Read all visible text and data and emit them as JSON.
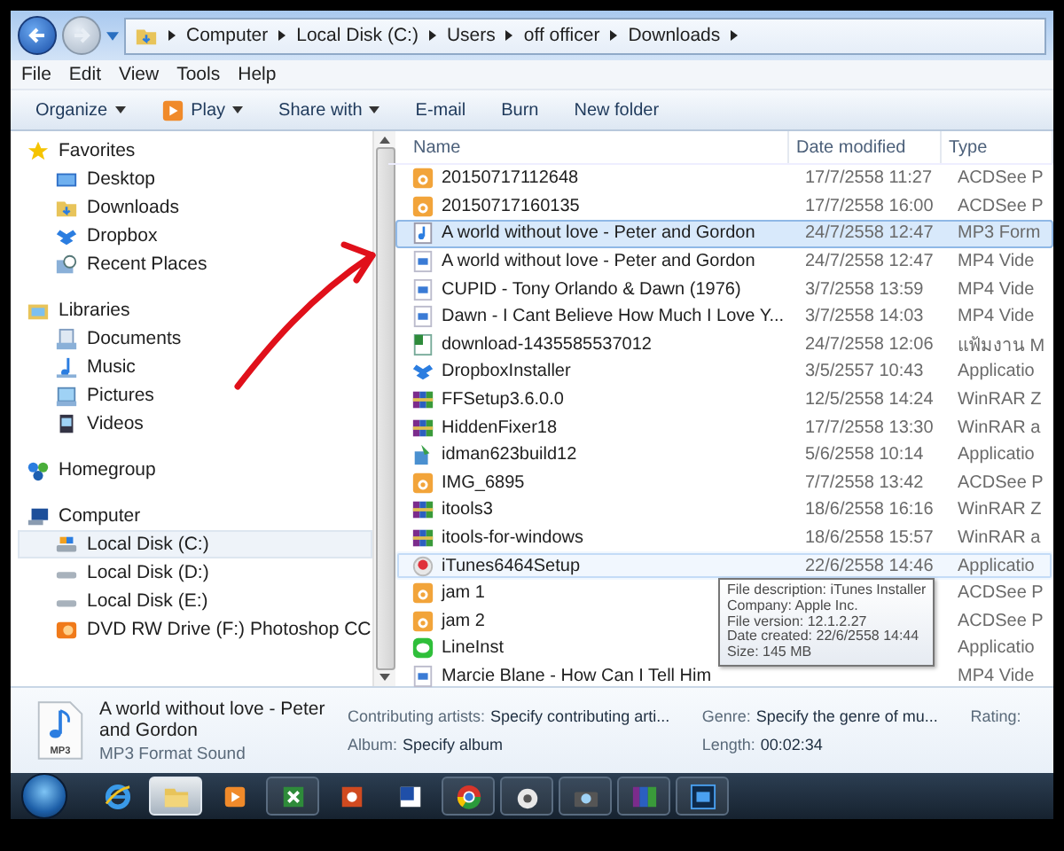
{
  "address_bar": {
    "segments": [
      "Computer",
      "Local Disk (C:)",
      "Users",
      "off officer",
      "Downloads"
    ]
  },
  "menu": [
    "File",
    "Edit",
    "View",
    "Tools",
    "Help"
  ],
  "toolbar": [
    {
      "label": "Organize",
      "kind": "plain",
      "dropdown": true
    },
    {
      "label": "Play",
      "kind": "play",
      "dropdown": true
    },
    {
      "label": "Share with",
      "kind": "plain",
      "dropdown": true
    },
    {
      "label": "E-mail",
      "kind": "plain",
      "dropdown": false
    },
    {
      "label": "Burn",
      "kind": "plain",
      "dropdown": false
    },
    {
      "label": "New folder",
      "kind": "plain",
      "dropdown": false
    }
  ],
  "navigation": [
    {
      "label": "Favorites",
      "kind": "star",
      "selected": false,
      "children": [
        {
          "label": "Desktop",
          "kind": "desktop",
          "selected": false
        },
        {
          "label": "Downloads",
          "kind": "folder",
          "selected": false
        },
        {
          "label": "Dropbox",
          "kind": "box",
          "selected": false
        },
        {
          "label": "Recent Places",
          "kind": "recent",
          "selected": false
        }
      ]
    },
    {
      "label": "Libraries",
      "kind": "library",
      "selected": false,
      "children": [
        {
          "label": "Documents",
          "kind": "documents",
          "selected": false
        },
        {
          "label": "Music",
          "kind": "music",
          "selected": false
        },
        {
          "label": "Pictures",
          "kind": "pictures",
          "selected": false
        },
        {
          "label": "Videos",
          "kind": "videos",
          "selected": false
        }
      ]
    },
    {
      "label": "Homegroup",
      "kind": "network",
      "selected": false
    },
    {
      "label": "Computer",
      "kind": "computer",
      "selected": false,
      "children": [
        {
          "label": "Local Disk (C:)",
          "kind": "system-disk",
          "selected": true
        },
        {
          "label": "Local Disk (D:)",
          "kind": "disk",
          "selected": false
        },
        {
          "label": "Local Disk (E:)",
          "kind": "disk",
          "selected": false
        },
        {
          "label": "DVD RW Drive (F:) Photoshop CC",
          "kind": "dvd",
          "selected": false
        }
      ]
    }
  ],
  "file_list": {
    "columns": [
      "Name",
      "Date modified",
      "Type"
    ],
    "rows": [
      {
        "name": "20150717112648",
        "date": "17/7/2558 11:27",
        "type": "ACDSee P",
        "kind": "image",
        "selected": false,
        "hovered": false
      },
      {
        "name": "20150717160135",
        "date": "17/7/2558 16:00",
        "type": "ACDSee P",
        "kind": "image",
        "selected": false,
        "hovered": false
      },
      {
        "name": "A world without love - Peter and Gordon",
        "date": "24/7/2558 12:47",
        "type": "MP3 Form",
        "kind": "audio",
        "selected": true,
        "hovered": false
      },
      {
        "name": "A world without love - Peter and Gordon",
        "date": "24/7/2558 12:47",
        "type": "MP4 Vide",
        "kind": "video",
        "selected": false,
        "hovered": false
      },
      {
        "name": "CUPID - Tony Orlando & Dawn (1976)",
        "date": "3/7/2558 13:59",
        "type": "MP4 Vide",
        "kind": "video",
        "selected": false,
        "hovered": false
      },
      {
        "name": "Dawn - I Cant Believe How Much I Love Y...",
        "date": "3/7/2558 14:03",
        "type": "MP4 Vide",
        "kind": "video",
        "selected": false,
        "hovered": false
      },
      {
        "name": "download-1435585537012",
        "date": "24/7/2558 12:06",
        "type": "แฟ้มงาน M",
        "kind": "sheet",
        "selected": false,
        "hovered": false
      },
      {
        "name": "DropboxInstaller",
        "date": "3/5/2557 10:43",
        "type": "Applicatio",
        "kind": "box",
        "selected": false,
        "hovered": false
      },
      {
        "name": "FFSetup3.6.0.0",
        "date": "12/5/2558 14:24",
        "type": "WinRAR Z",
        "kind": "archive",
        "selected": false,
        "hovered": false
      },
      {
        "name": "HiddenFixer18",
        "date": "17/7/2558 13:30",
        "type": "WinRAR a",
        "kind": "archive",
        "selected": false,
        "hovered": false
      },
      {
        "name": "idman623build12",
        "date": "5/6/2558 10:14",
        "type": "Applicatio",
        "kind": "installer",
        "selected": false,
        "hovered": false
      },
      {
        "name": "IMG_6895",
        "date": "7/7/2558 13:42",
        "type": "ACDSee P",
        "kind": "image",
        "selected": false,
        "hovered": false
      },
      {
        "name": "itools3",
        "date": "18/6/2558 16:16",
        "type": "WinRAR Z",
        "kind": "archive",
        "selected": false,
        "hovered": false
      },
      {
        "name": "itools-for-windows",
        "date": "18/6/2558 15:57",
        "type": "WinRAR a",
        "kind": "archive",
        "selected": false,
        "hovered": false
      },
      {
        "name": "iTunes6464Setup",
        "date": "22/6/2558 14:46",
        "type": "Applicatio",
        "kind": "setup",
        "selected": false,
        "hovered": true
      },
      {
        "name": "jam 1",
        "type": "ACDSee P",
        "kind": "image",
        "selected": false,
        "hovered": false
      },
      {
        "name": "jam 2",
        "type": "ACDSee P",
        "kind": "image",
        "selected": false,
        "hovered": false
      },
      {
        "name": "LineInst",
        "type": "Applicatio",
        "kind": "chat",
        "selected": false,
        "hovered": false
      },
      {
        "name": "Marcie Blane - How Can I Tell Him",
        "type": "MP4 Vide",
        "kind": "video",
        "selected": false,
        "hovered": false
      }
    ]
  },
  "tooltip": {
    "lines": [
      "File description: iTunes Installer",
      "Company: Apple Inc.",
      "File version: 12.1.2.27",
      "Date created: 22/6/2558 14:44",
      "Size: 145 MB"
    ]
  },
  "details": {
    "icon_label": "MP3",
    "title": "A world without love - Peter and Gordon",
    "subtitle": "MP3 Format Sound",
    "fields": [
      {
        "label": "Contributing artists:",
        "value": "Specify contributing arti..."
      },
      {
        "label": "Genre:",
        "value": "Specify the genre of mu..."
      },
      {
        "label": "Rating:"
      },
      {
        "label": "Album:",
        "value": "Specify album"
      },
      {
        "label": "Length:",
        "value": "00:02:34"
      }
    ]
  },
  "taskbar": [
    {
      "kind": "browser-e",
      "running": false,
      "active": false
    },
    {
      "kind": "folder",
      "running": true,
      "active": true
    },
    {
      "kind": "media",
      "running": false,
      "active": false
    },
    {
      "kind": "sheet",
      "running": true,
      "active": false
    },
    {
      "kind": "slides",
      "running": false,
      "active": false
    },
    {
      "kind": "doc",
      "running": false,
      "active": false
    },
    {
      "kind": "chrome",
      "running": true,
      "active": false
    },
    {
      "kind": "app",
      "running": true,
      "active": false
    },
    {
      "kind": "camera",
      "running": true,
      "active": false
    },
    {
      "kind": "archive",
      "running": true,
      "active": false
    },
    {
      "kind": "photo-editor",
      "running": true,
      "active": false
    }
  ]
}
